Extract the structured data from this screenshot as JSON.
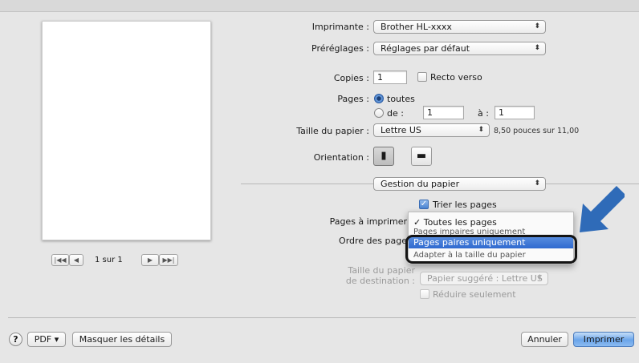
{
  "printer": {
    "label": "Imprimante :",
    "value": "Brother HL-xxxx"
  },
  "presets": {
    "label": "Préréglages :",
    "value": "Réglages par défaut"
  },
  "copies": {
    "label": "Copies :",
    "value": "1",
    "duplex_label": "Recto verso"
  },
  "pages": {
    "label": "Pages :",
    "all_label": "toutes",
    "from_label": "de :",
    "from_value": "1",
    "to_label": "à :",
    "to_value": "1"
  },
  "paper_size": {
    "label": "Taille du papier :",
    "value": "Lettre US",
    "dimensions": "8,50 pouces sur 11,00"
  },
  "orientation": {
    "label": "Orientation :",
    "portrait_icon": "portrait-icon",
    "landscape_icon": "landscape-icon"
  },
  "section": {
    "value": "Gestion du papier"
  },
  "collate": {
    "label": "Trier les pages",
    "checked": true
  },
  "pages_to_print": {
    "label": "Pages à imprimer"
  },
  "page_order": {
    "label": "Ordre des page"
  },
  "menu": {
    "items": [
      {
        "label": "✓ Toutes les pages"
      },
      {
        "label": "Pages impaires uniquement"
      },
      {
        "label": "Pages paires uniquement"
      },
      {
        "label": "Adapter à la taille du papier"
      }
    ]
  },
  "dest_paper": {
    "label_line1": "Taille du papier",
    "label_line2": "de destination :",
    "value": "Papier suggéré : Lettre US",
    "reduce_label": "Réduire seulement"
  },
  "pager": {
    "text": "1 sur 1",
    "first": "|◀◀",
    "prev": "◀",
    "next": "▶",
    "last": "▶▶|"
  },
  "footer": {
    "help": "?",
    "pdf": "PDF ▾",
    "hide_details": "Masquer les détails",
    "cancel": "Annuler",
    "print": "Imprimer"
  },
  "colors": {
    "accent": "#3a7fd5",
    "arrow": "#2f6bb8"
  }
}
